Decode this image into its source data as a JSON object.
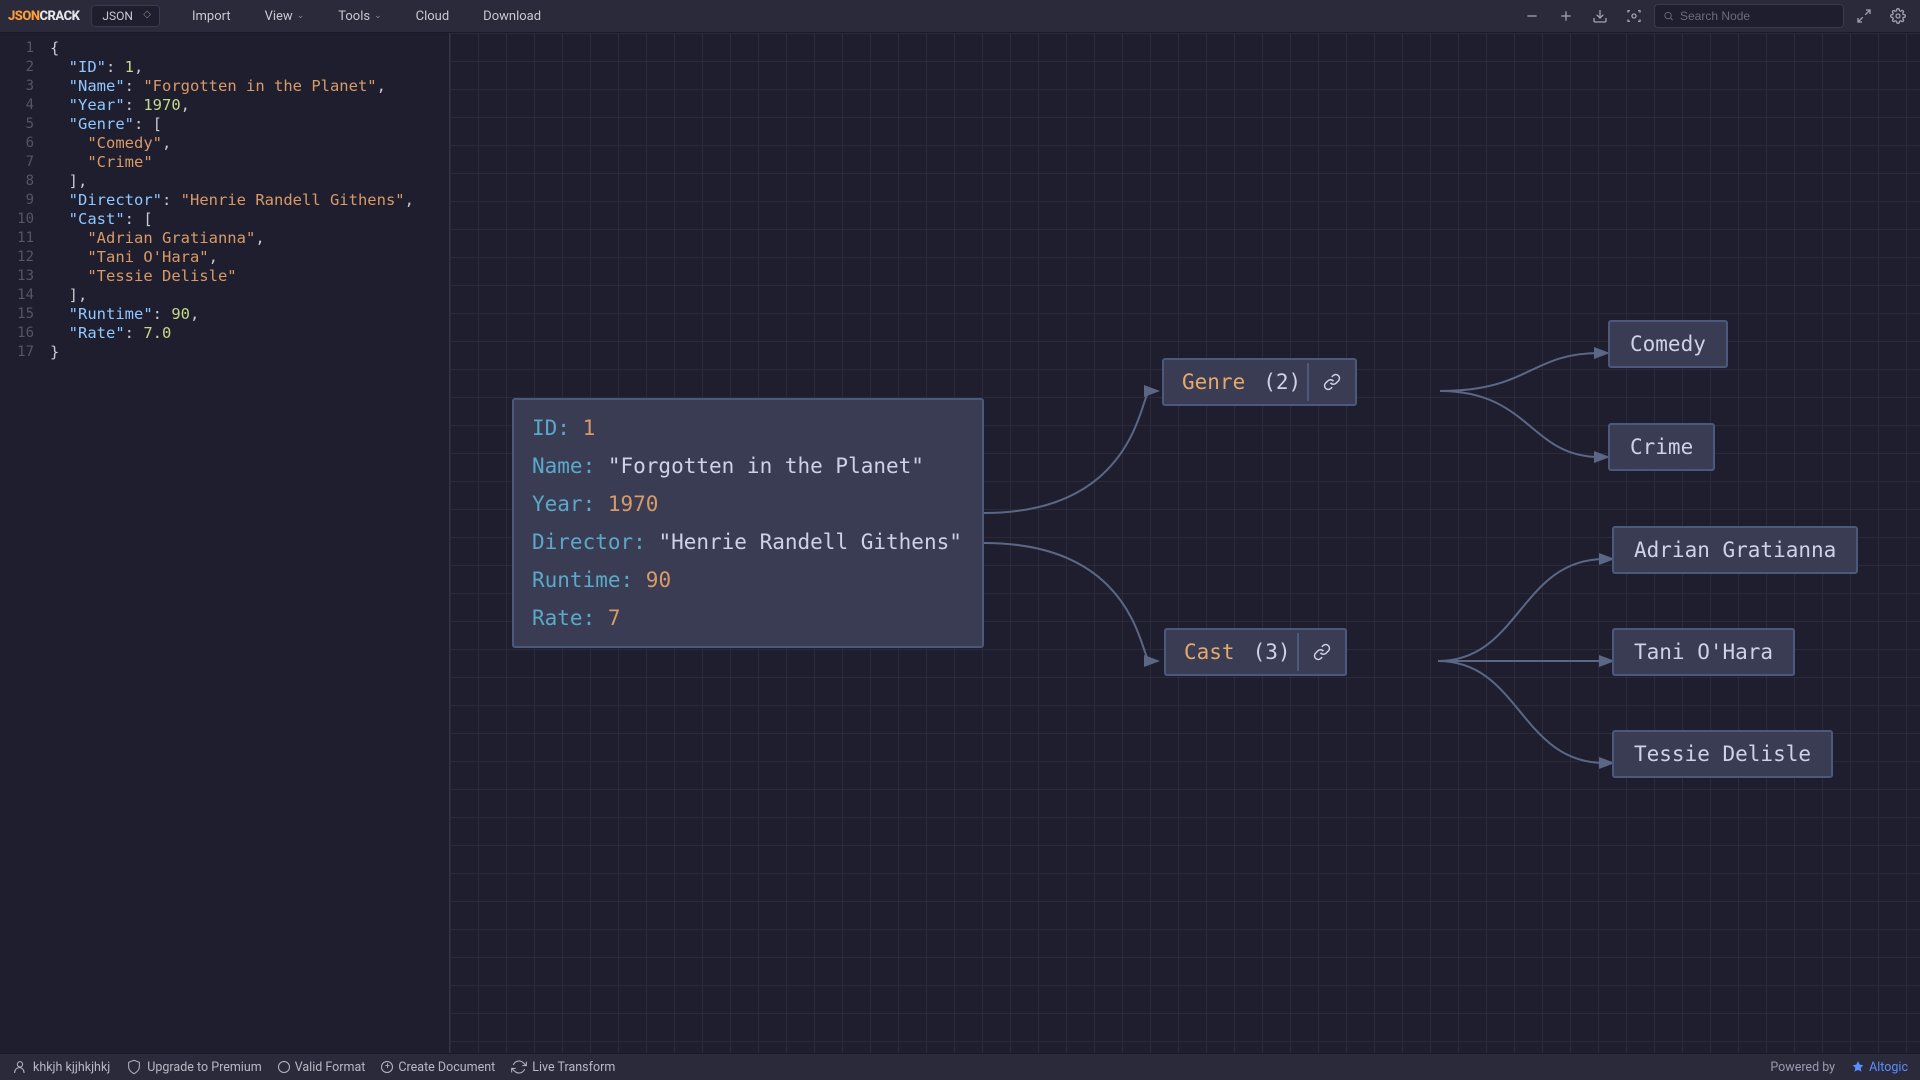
{
  "brand": {
    "part1": "JSON",
    "part2": "CRACK"
  },
  "format_select": "JSON",
  "menu": {
    "import": "Import",
    "view": "View",
    "tools": "Tools",
    "cloud": "Cloud",
    "download": "Download"
  },
  "search_placeholder": "Search Node",
  "editor": {
    "ID": 1,
    "Name": "Forgotten in the Planet",
    "Year": 1970,
    "Genre": [
      "Comedy",
      "Crime"
    ],
    "Director": "Henrie Randell Githens",
    "Cast": [
      "Adrian Gratianna",
      "Tani O'Hara",
      "Tessie Delisle"
    ],
    "Runtime": 90,
    "Rate": 7.0,
    "line_count": 17
  },
  "graph": {
    "root": [
      {
        "k": "ID",
        "v": "1",
        "t": "num"
      },
      {
        "k": "Name",
        "v": "\"Forgotten in the Planet\"",
        "t": "str"
      },
      {
        "k": "Year",
        "v": "1970",
        "t": "num"
      },
      {
        "k": "Director",
        "v": "\"Henrie Randell Githens\"",
        "t": "str"
      },
      {
        "k": "Runtime",
        "v": "90",
        "t": "num"
      },
      {
        "k": "Rate",
        "v": "7",
        "t": "num"
      }
    ],
    "branches": [
      {
        "label": "Genre",
        "count": "(2)",
        "leaves": [
          "Comedy",
          "Crime"
        ]
      },
      {
        "label": "Cast",
        "count": "(3)",
        "leaves": [
          "Adrian Gratianna",
          "Tani O'Hara",
          "Tessie Delisle"
        ]
      }
    ]
  },
  "status": {
    "user": "khkjh kjjhkjhkj",
    "upgrade": "Upgrade to Premium",
    "valid": "Valid Format",
    "create": "Create Document",
    "live": "Live Transform",
    "powered": "Powered by",
    "altogic": "Altogic"
  }
}
